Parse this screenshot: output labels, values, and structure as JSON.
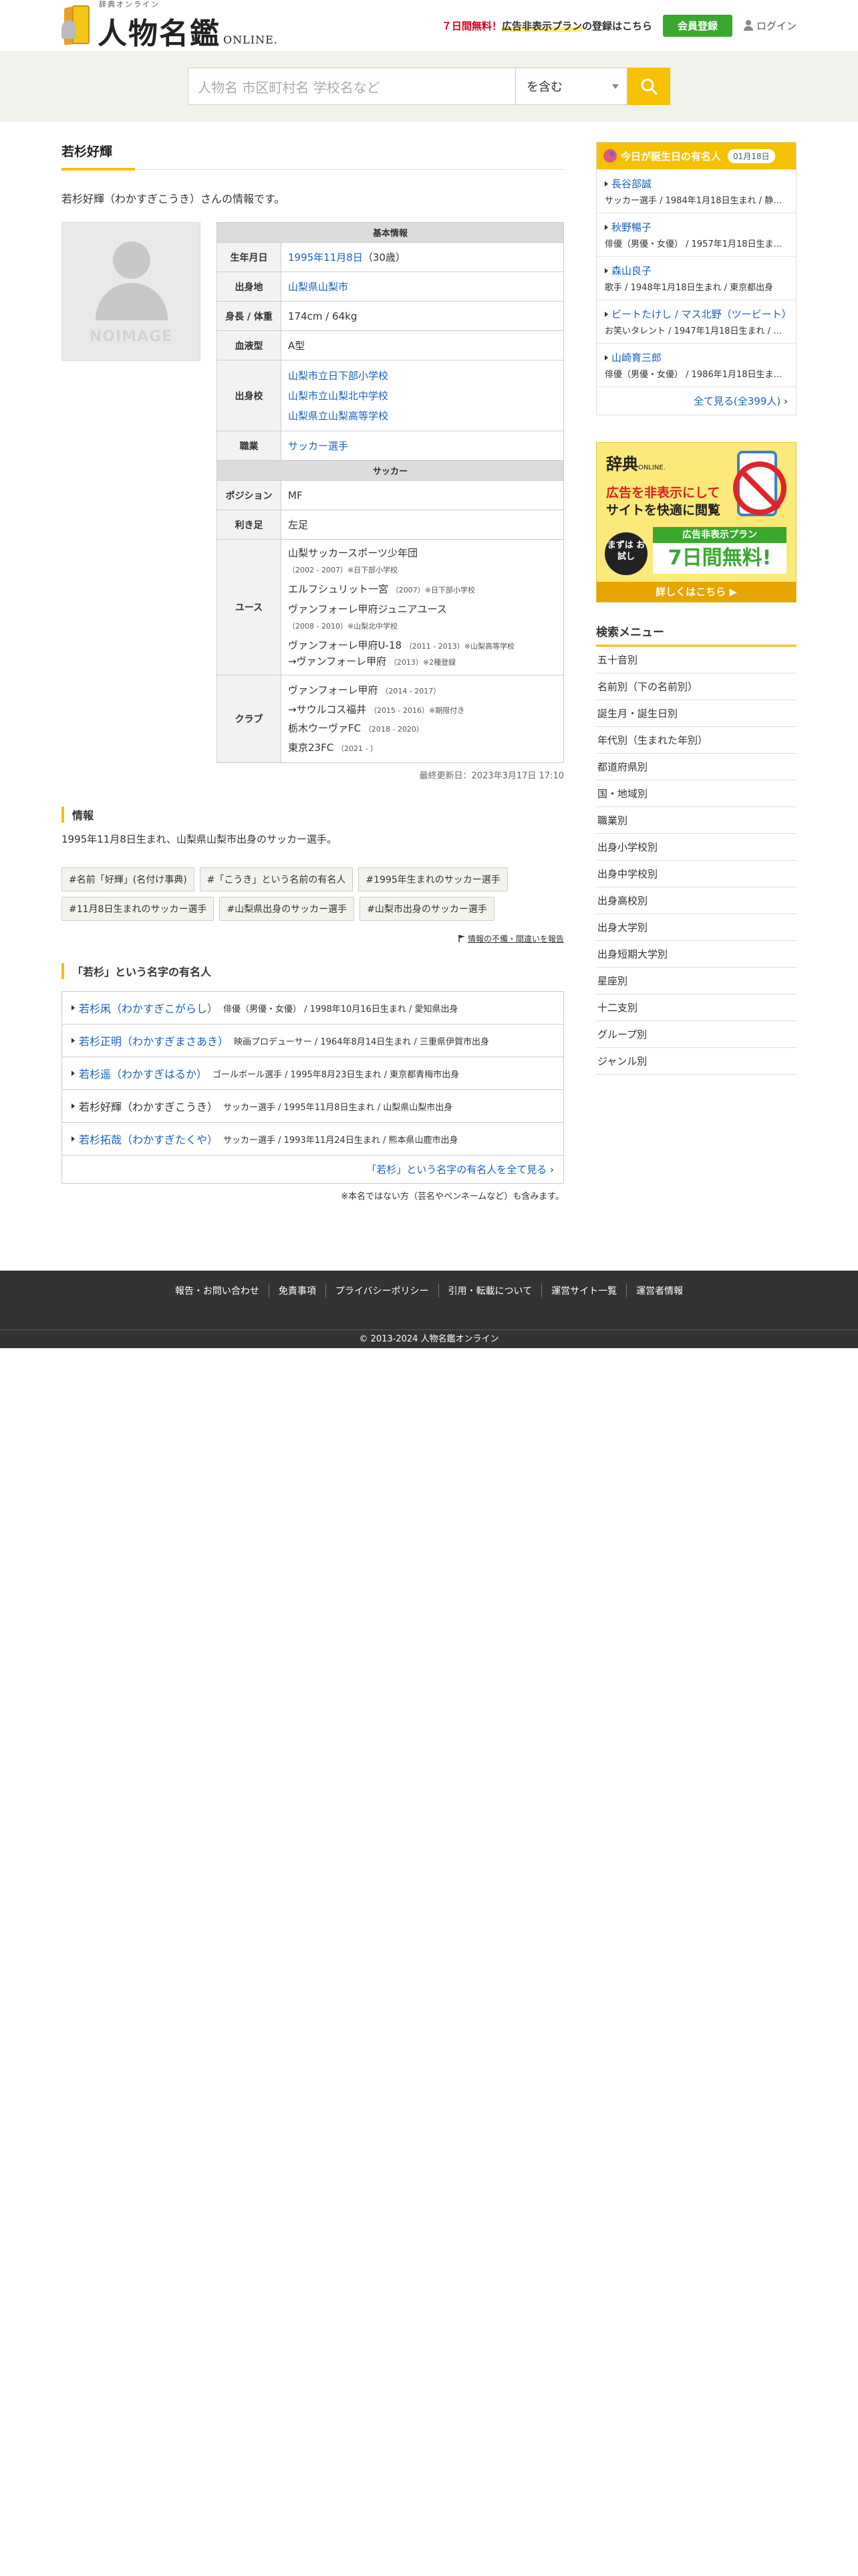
{
  "header": {
    "logo_sub": "辞典オンライン",
    "logo_main": "人物名鑑",
    "logo_en": "ONLINE.",
    "promo_red": "７日間無料！",
    "promo_highlight": "広告非表示プラン",
    "promo_rest": "の登録はこちら",
    "register_label": "会員登録",
    "login_label": "ログイン"
  },
  "search": {
    "placeholder": "人物名 市区町村名 学校名など",
    "mode": "を含む"
  },
  "page": {
    "title": "若杉好輝",
    "intro": "若杉好輝（わかすぎこうき）さんの情報です。",
    "noimage": "NOIMAGE"
  },
  "basic": {
    "section": "基本情報",
    "birth_label": "生年月日",
    "birth_date": "1995年11月8日",
    "birth_age": "（30歳）",
    "birthplace_label": "出身地",
    "birthplace": "山梨県山梨市",
    "size_label": "身長 / 体重",
    "size": "174cm / 64kg",
    "blood_label": "血液型",
    "blood": "A型",
    "school_label": "出身校",
    "schools": [
      "山梨市立日下部小学校",
      "山梨市立山梨北中学校",
      "山梨県立山梨高等学校"
    ],
    "job_label": "職業",
    "job": "サッカー選手"
  },
  "soccer": {
    "section": "サッカー",
    "position_label": "ポジション",
    "position": "MF",
    "foot_label": "利き足",
    "foot": "左足",
    "youth_label": "ユース",
    "youth": [
      {
        "name": "山梨サッカースポーツ少年団",
        "note": "（2002 - 2007）※日下部小学校",
        "break": true
      },
      {
        "name": "エルフシュリット一宮",
        "note": "（2007）※日下部小学校",
        "break": false
      },
      {
        "name": "ヴァンフォーレ甲府ジュニアユース",
        "note": "（2008 - 2010）※山梨北中学校",
        "break": true
      },
      {
        "name": "ヴァンフォーレ甲府U-18",
        "note": "（2011 - 2013）※山梨高等学校",
        "break": false
      },
      {
        "name": "→ヴァンフォーレ甲府",
        "note": "（2013）※2種登録",
        "break": false
      }
    ],
    "club_label": "クラブ",
    "clubs": [
      {
        "name": "ヴァンフォーレ甲府",
        "note": "（2014 - 2017）"
      },
      {
        "name": "→サウルコス福井",
        "note": "（2015 - 2016）※期限付き"
      },
      {
        "name": "栃木ウーヴァFC",
        "note": "（2018 - 2020）"
      },
      {
        "name": "東京23FC",
        "note": "（2021 - ）"
      }
    ]
  },
  "updated": "最終更新日：2023年3月17日 17:10",
  "info": {
    "heading": "情報",
    "text": "1995年11月8日生まれ、山梨県山梨市出身のサッカー選手。"
  },
  "tags": [
    "#名前「好輝」(名付け事典)",
    "#「こうき」という名前の有名人",
    "#1995年生まれのサッカー選手",
    "#11月8日生まれのサッカー選手",
    "#山梨県出身のサッカー選手",
    "#山梨市出身のサッカー選手"
  ],
  "report": "情報の不備・間違いを報告",
  "same_surname": {
    "heading": "「若杉」という名字の有名人",
    "items": [
      {
        "name": "若杉凩（わかすぎこがらし）",
        "desc": "俳優（男優・女優） / 1998年10月16日生まれ / 愛知県出身",
        "linked": true
      },
      {
        "name": "若杉正明（わかすぎまさあき）",
        "desc": "映画プロデューサー / 1964年8月14日生まれ / 三重県伊賀市出身",
        "linked": true
      },
      {
        "name": "若杉遥（わかすぎはるか）",
        "desc": "ゴールボール選手 / 1995年8月23日生まれ / 東京都青梅市出身",
        "linked": true
      },
      {
        "name": "若杉好輝（わかすぎこうき）",
        "desc": "サッカー選手 / 1995年11月8日生まれ / 山梨県山梨市出身",
        "linked": false
      },
      {
        "name": "若杉拓哉（わかすぎたくや）",
        "desc": "サッカー選手 / 1993年11月24日生まれ / 熊本県山鹿市出身",
        "linked": true
      }
    ],
    "more": "「若杉」という名字の有名人を全て見る",
    "note": "※本名ではない方（芸名やペンネームなど）も含みます。"
  },
  "birthday": {
    "heading": "今日が誕生日の有名人",
    "date": "01月18日",
    "items": [
      {
        "name": "長谷部誠",
        "desc": "サッカー選手 / 1984年1月18日生まれ / 静岡県出身"
      },
      {
        "name": "秋野暢子",
        "desc": "俳優（男優・女優） / 1957年1月18日生まれ / 大阪府出身"
      },
      {
        "name": "森山良子",
        "desc": "歌手 / 1948年1月18日生まれ / 東京都出身"
      },
      {
        "name": "ビートたけし / マス北野（ツービート）",
        "desc": "お笑いタレント / 1947年1月18日生まれ / 東京都出身"
      },
      {
        "name": "山崎育三郎",
        "desc": "俳優（男優・女優） / 1986年1月18日生まれ / 東京都出身"
      }
    ],
    "more": "全て見る(全399人)"
  },
  "ad": {
    "logo": "辞典",
    "logo_small": "ONLINE.",
    "line1": "広告を非表示にして",
    "line2": "サイトを快適に閲覧",
    "trial": "まずは お試し",
    "plan": "広告非表示プラン",
    "days": "7日間無料!",
    "cta": "詳しくはこちら ▶"
  },
  "menu": {
    "title": "検索メニュー",
    "items": [
      "五十音別",
      "名前別（下の名前別）",
      "誕生月・誕生日別",
      "年代別（生まれた年別）",
      "都道府県別",
      "国・地域別",
      "職業別",
      "出身小学校別",
      "出身中学校別",
      "出身高校別",
      "出身大学別",
      "出身短期大学別",
      "星座別",
      "十二支別",
      "グループ別",
      "ジャンル別"
    ]
  },
  "footer": {
    "links": [
      "報告・お問い合わせ",
      "免責事項",
      "プライバシーポリシー",
      "引用・転載について",
      "運営サイト一覧",
      "運営者情報"
    ],
    "copyright": "© 2013-2024 人物名鑑オンライン"
  }
}
